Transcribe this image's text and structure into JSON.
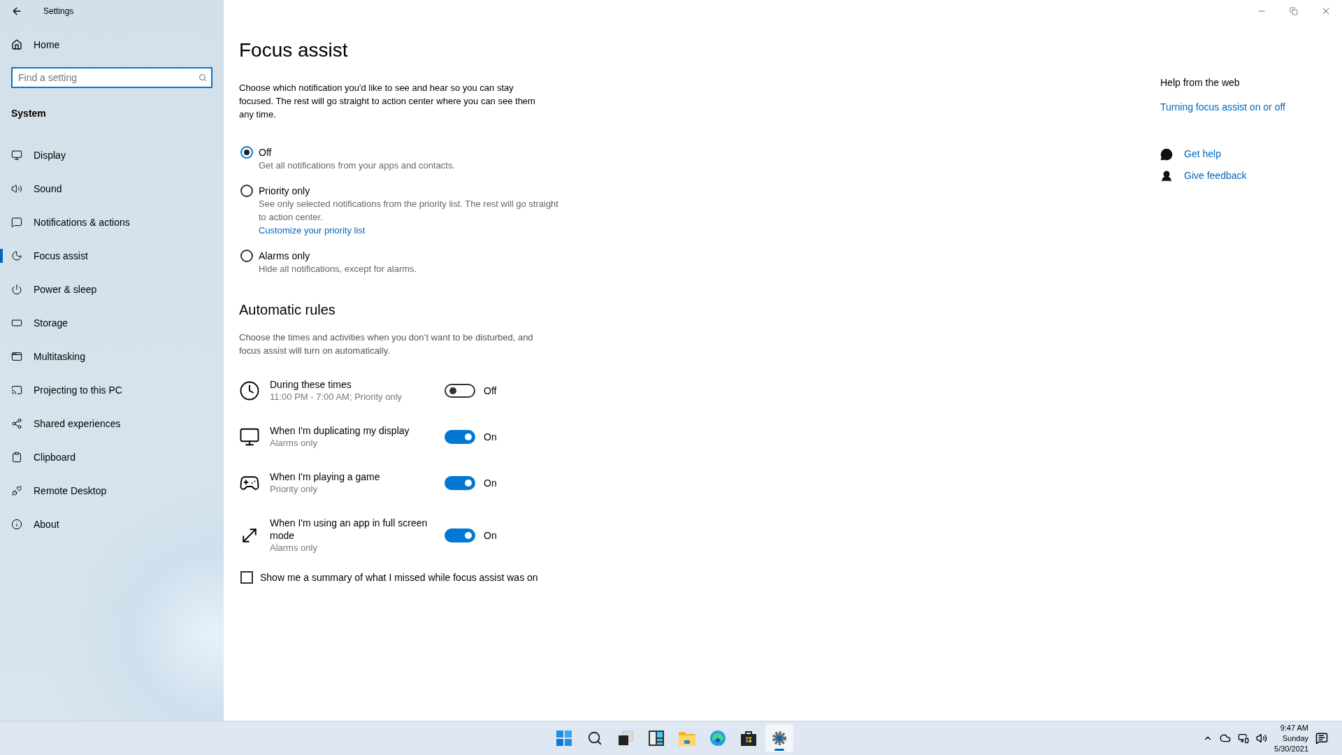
{
  "window": {
    "title": "Settings"
  },
  "sidebar": {
    "home": "Home",
    "search": {
      "placeholder": "Find a setting"
    },
    "section": "System",
    "items": [
      {
        "label": "Display",
        "selected": false
      },
      {
        "label": "Sound",
        "selected": false
      },
      {
        "label": "Notifications & actions",
        "selected": false
      },
      {
        "label": "Focus assist",
        "selected": true
      },
      {
        "label": "Power & sleep",
        "selected": false
      },
      {
        "label": "Storage",
        "selected": false
      },
      {
        "label": "Multitasking",
        "selected": false
      },
      {
        "label": "Projecting to this PC",
        "selected": false
      },
      {
        "label": "Shared experiences",
        "selected": false
      },
      {
        "label": "Clipboard",
        "selected": false
      },
      {
        "label": "Remote Desktop",
        "selected": false
      },
      {
        "label": "About",
        "selected": false
      }
    ]
  },
  "page": {
    "title": "Focus assist",
    "intro": "Choose which notification you'd like to see and hear so you can stay focused. The rest will go straight to action center where you can see them any time.",
    "options": [
      {
        "label": "Off",
        "selected": true,
        "description": "Get all notifications from your apps and contacts."
      },
      {
        "label": "Priority only",
        "selected": false,
        "description": "See only selected notifications from the priority list. The rest will go straight to action center.",
        "link": "Customize your priority list"
      },
      {
        "label": "Alarms only",
        "selected": false,
        "description": "Hide all notifications, except for alarms."
      }
    ],
    "rules_title": "Automatic rules",
    "rules_intro": "Choose the times and activities when you don’t want to be disturbed, and focus assist will turn on automatically.",
    "rules": [
      {
        "kind": "clock",
        "title": "During these times",
        "subtitle": "11:00 PM - 7:00 AM; Priority only",
        "on": false,
        "state": "Off"
      },
      {
        "kind": "display",
        "title": "When I'm duplicating my display",
        "subtitle": "Alarms only",
        "on": true,
        "state": "On"
      },
      {
        "kind": "game",
        "title": "When I'm playing a game",
        "subtitle": "Priority only",
        "on": true,
        "state": "On"
      },
      {
        "kind": "fullscreen",
        "title": "When I'm using an app in full screen mode",
        "subtitle": "Alarms only",
        "on": true,
        "state": "On"
      }
    ],
    "summary": {
      "label": "Show me a summary of what I missed while focus assist was on",
      "checked": false
    }
  },
  "help": {
    "title": "Help from the web",
    "link": "Turning focus assist on or off",
    "actions": [
      {
        "kind": "help",
        "label": "Get help"
      },
      {
        "kind": "feedback",
        "label": "Give feedback"
      }
    ]
  },
  "taskbar": {
    "apps": [
      {
        "kind": "start",
        "selected": false
      },
      {
        "kind": "search",
        "selected": false
      },
      {
        "kind": "taskview",
        "selected": false
      },
      {
        "kind": "widgets",
        "selected": false
      },
      {
        "kind": "explorer",
        "selected": false
      },
      {
        "kind": "edge",
        "selected": false
      },
      {
        "kind": "store",
        "selected": false
      },
      {
        "kind": "settings",
        "selected": true
      }
    ],
    "time": "9:47 AM",
    "day": "Sunday",
    "date": "5/30/2021"
  }
}
